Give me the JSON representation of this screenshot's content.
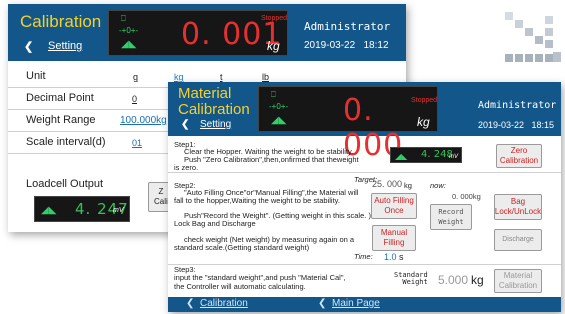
{
  "logo_squares": 13,
  "back_panel": {
    "title": "Calibration",
    "back_label": "Setting",
    "lcd": {
      "value": "0. 001",
      "unit": "kg",
      "status": "Stopped",
      "icons": [
        "-+0+-",
        "◢◣"
      ]
    },
    "user": "Administrator",
    "datetime": "2019-03-22   18:12",
    "rows": [
      {
        "label": "Unit",
        "options": [
          "g",
          "kg",
          "t",
          "lb"
        ]
      },
      {
        "label": "Decimal Point",
        "options": [
          "0"
        ]
      },
      {
        "label": "Weight Range",
        "options": [
          "100.000kg"
        ]
      },
      {
        "label": "Scale interval(d)",
        "options": [
          "01"
        ]
      }
    ],
    "loadcell": {
      "label": "Loadcell Output",
      "value": "4. 247",
      "unit": "mV",
      "button_partial": "Z\nCali"
    }
  },
  "front_panel": {
    "title_line1": "Material",
    "title_line2": "Calibration",
    "back_label": "Setting",
    "lcd": {
      "value": "0. 000",
      "unit": "kg",
      "status": "Stopped"
    },
    "user": "Administrator",
    "datetime": "2019-03-22   18:15",
    "step1": {
      "heading": "Step1:",
      "line1": "Clear the Hopper. Waiting the weight to be stability.",
      "line2": "Push \"Zero Calibration\",then,onfirmed that theweight",
      "line3": "is zero.",
      "mini_value": "4. 248",
      "mini_unit": "mV",
      "zero_button": "Zero\nCalibration"
    },
    "step2": {
      "heading": "Step2:",
      "line1": "\"Auto Filling Once\"or\"Manual Filling\",the Material will",
      "line2": "fall to the hopper,Waiting the weight to be stability.",
      "line3": "Push\"Record the Weight\". (Getting weight in this scale. )",
      "line4": "Lock Bag and Discharge",
      "line5": "check weight (Net weight) by measuring again on a",
      "line6": "standard scale.(Getting standard weight)",
      "target_label": "Target:",
      "target_value": "25. 000",
      "target_unit": "kg",
      "now_label": "now:",
      "now_value": "0. 000kg",
      "auto_fill_button": "Auto Filling\nOnce",
      "record_button": "Record\nWeight",
      "bag_button": "Bag\nLock/UnLock",
      "manual_button": "Manual\nFilling",
      "discharge_button": "Discharge",
      "time_label": "Time:",
      "time_value": "1.0",
      "time_unit": "s"
    },
    "step3": {
      "heading": "Step3:",
      "line1": "input the \"standard weight\",and push \"Material Cal\",",
      "line2": "the Controller will automatic calculating.",
      "std_label": "Standard\nWeight",
      "std_value": "5.000",
      "std_unit": "kg",
      "material_button": "Material\nCalibration"
    },
    "footer": {
      "calibration_link": "Calibration",
      "main_link": "Main Page"
    }
  }
}
